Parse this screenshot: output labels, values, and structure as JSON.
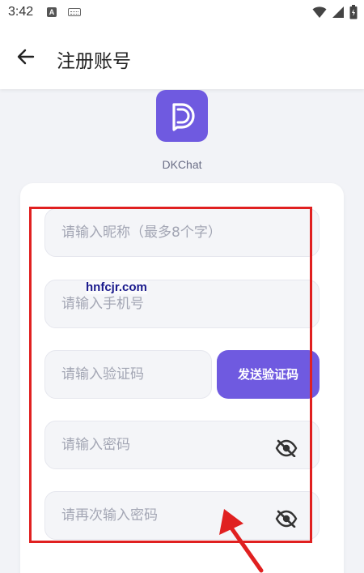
{
  "status_bar": {
    "time": "3:42",
    "icons": [
      "a-notification-icon",
      "keyboard-icon",
      "wifi-icon",
      "signal-icon",
      "battery-icon"
    ]
  },
  "app_bar": {
    "title": "注册账号",
    "back_icon": "arrow-left-icon"
  },
  "app": {
    "name": "DKChat",
    "brand_color": "#6f5ae0"
  },
  "form": {
    "nickname_placeholder": "请输入昵称（最多8个字）",
    "phone_placeholder": "请输入手机号",
    "code_placeholder": "请输入验证码",
    "send_code_label": "发送验证码",
    "password_placeholder": "请输入密码",
    "confirm_password_placeholder": "请再次输入密码",
    "password_toggle_icon": "eye-off-icon"
  },
  "annotation": {
    "watermark": "hnfcjr.com",
    "highlight_color": "#e02020"
  }
}
